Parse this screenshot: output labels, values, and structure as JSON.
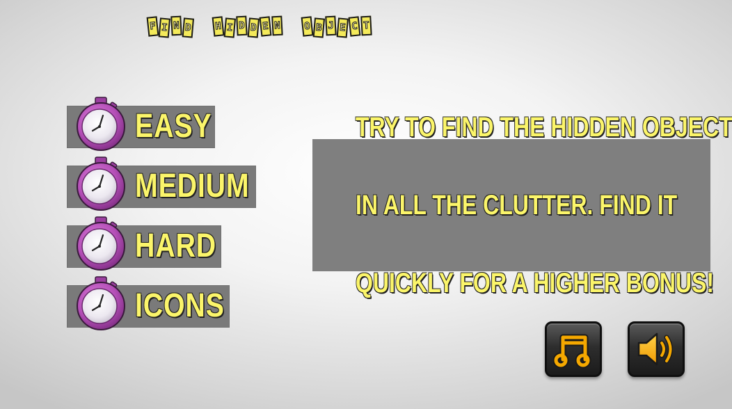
{
  "title": {
    "words": [
      [
        "F",
        "I",
        "N",
        "D"
      ],
      [
        "H",
        "I",
        "D",
        "D",
        "E",
        "N"
      ],
      [
        "O",
        "B",
        "J",
        "E",
        "C",
        "T"
      ]
    ]
  },
  "menu": {
    "items": [
      {
        "label": "EASY",
        "icon": "stopwatch-icon"
      },
      {
        "label": "MEDIUM",
        "icon": "stopwatch-icon"
      },
      {
        "label": "HARD",
        "icon": "stopwatch-icon"
      },
      {
        "label": "ICONS",
        "icon": "stopwatch-icon"
      }
    ]
  },
  "info": {
    "lines": [
      "TRY TO FIND THE HIDDEN OBJECT",
      "IN ALL THE CLUTTER. FIND IT",
      "QUICKLY FOR A HIGHER BONUS!"
    ]
  },
  "controls": {
    "music_icon": "music-note-icon",
    "sound_icon": "speaker-icon"
  },
  "colors": {
    "text_yellow": "#fbf56a",
    "panel_gray": "#7f7f7f",
    "clock_purple": "#b44fb7",
    "icon_orange": "#f5a800"
  }
}
